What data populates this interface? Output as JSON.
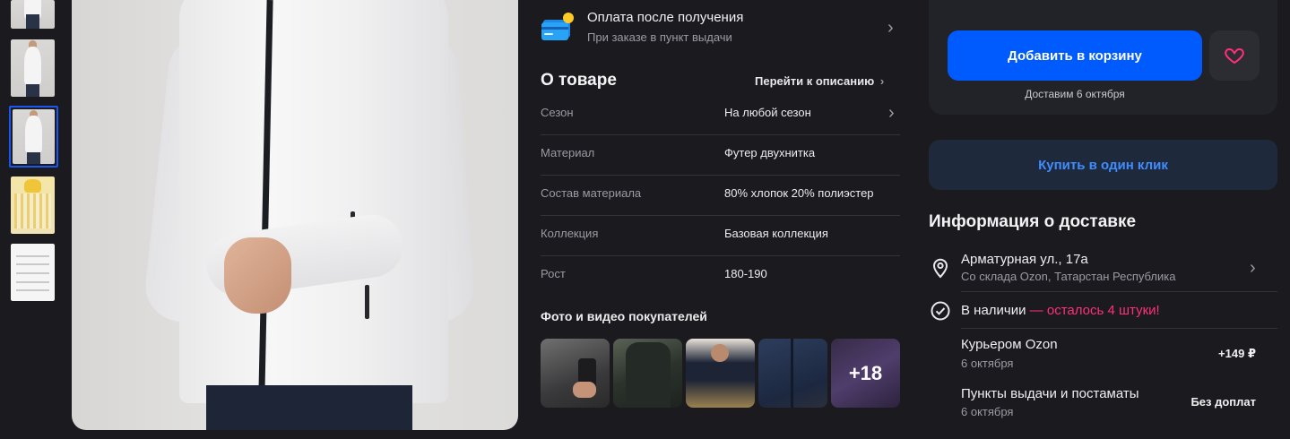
{
  "payment": {
    "title": "Оплата после получения",
    "subtitle": "При заказе в пункт выдачи"
  },
  "about": {
    "title": "О товаре",
    "link": "Перейти к описанию",
    "specs": [
      {
        "name": "Сезон",
        "value": "На любой сезон"
      },
      {
        "name": "Материал",
        "value": "Футер двухнитка"
      },
      {
        "name": "Состав материала",
        "value": "80% хлопок 20% полиэстер"
      },
      {
        "name": "Коллекция",
        "value": "Базовая коллекция"
      },
      {
        "name": "Рост",
        "value": "180-190"
      }
    ]
  },
  "ugc": {
    "title": "Фото и видео покупателей",
    "more_count": "+18"
  },
  "buy": {
    "cart_button": "Добавить в корзину",
    "delivery_date": "Доставим 6 октября",
    "one_click_button": "Купить в один клик"
  },
  "delivery": {
    "title": "Информация о доставке",
    "address": "Арматурная ул., 17а",
    "warehouse": "Со склада Ozon, Татарстан Республика",
    "stock_label": "В наличии",
    "stock_left": " — осталось 4 штуки!",
    "options": [
      {
        "title": "Курьером Ozon",
        "date": "6 октября",
        "price": "+149 ₽"
      },
      {
        "title": "Пункты выдачи и постаматы",
        "date": "6 октября",
        "price": "Без доплат"
      }
    ]
  },
  "colors": {
    "accent": "#005bff",
    "accent_text": "#3f8cff",
    "stock_warning": "#ff2f7a",
    "background": "#1b1b1f"
  }
}
